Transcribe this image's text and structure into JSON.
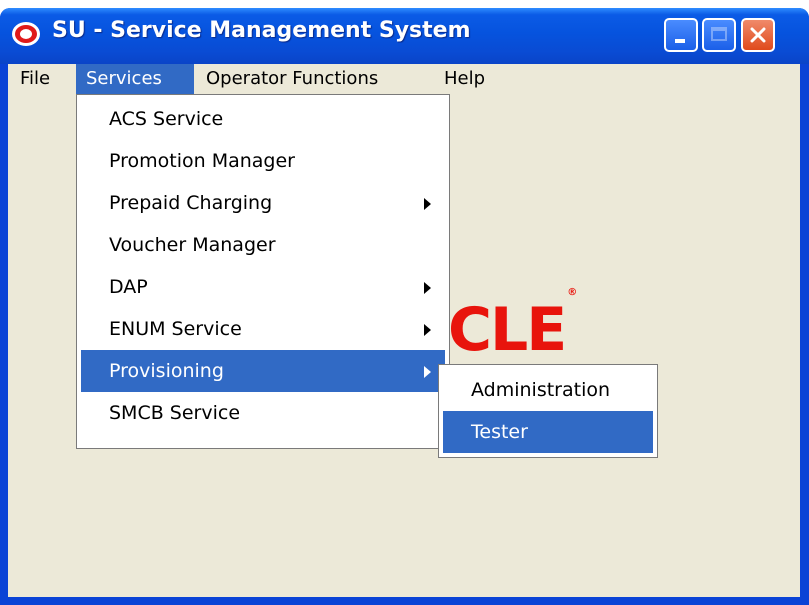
{
  "window": {
    "title": "SU - Service Management System"
  },
  "menubar": {
    "items": [
      {
        "label": "File"
      },
      {
        "label": "Services"
      },
      {
        "label": "Operator Functions"
      },
      {
        "label": "Help"
      }
    ]
  },
  "services_menu": {
    "items": [
      {
        "label": "ACS Service",
        "has_submenu": false
      },
      {
        "label": "Promotion Manager",
        "has_submenu": false
      },
      {
        "label": "Prepaid Charging",
        "has_submenu": true
      },
      {
        "label": "Voucher Manager",
        "has_submenu": false
      },
      {
        "label": "DAP",
        "has_submenu": true
      },
      {
        "label": "ENUM Service",
        "has_submenu": true
      },
      {
        "label": "Provisioning",
        "has_submenu": true,
        "highlighted": true
      },
      {
        "label": "SMCB Service",
        "has_submenu": false
      }
    ]
  },
  "provisioning_submenu": {
    "items": [
      {
        "label": "Administration"
      },
      {
        "label": "Tester",
        "highlighted": true
      }
    ]
  },
  "background_logo": {
    "text": "CLE",
    "mark": "®"
  },
  "colors": {
    "highlight": "#316ac5",
    "titlebar": "#0653de",
    "logo_red": "#e8140c"
  }
}
